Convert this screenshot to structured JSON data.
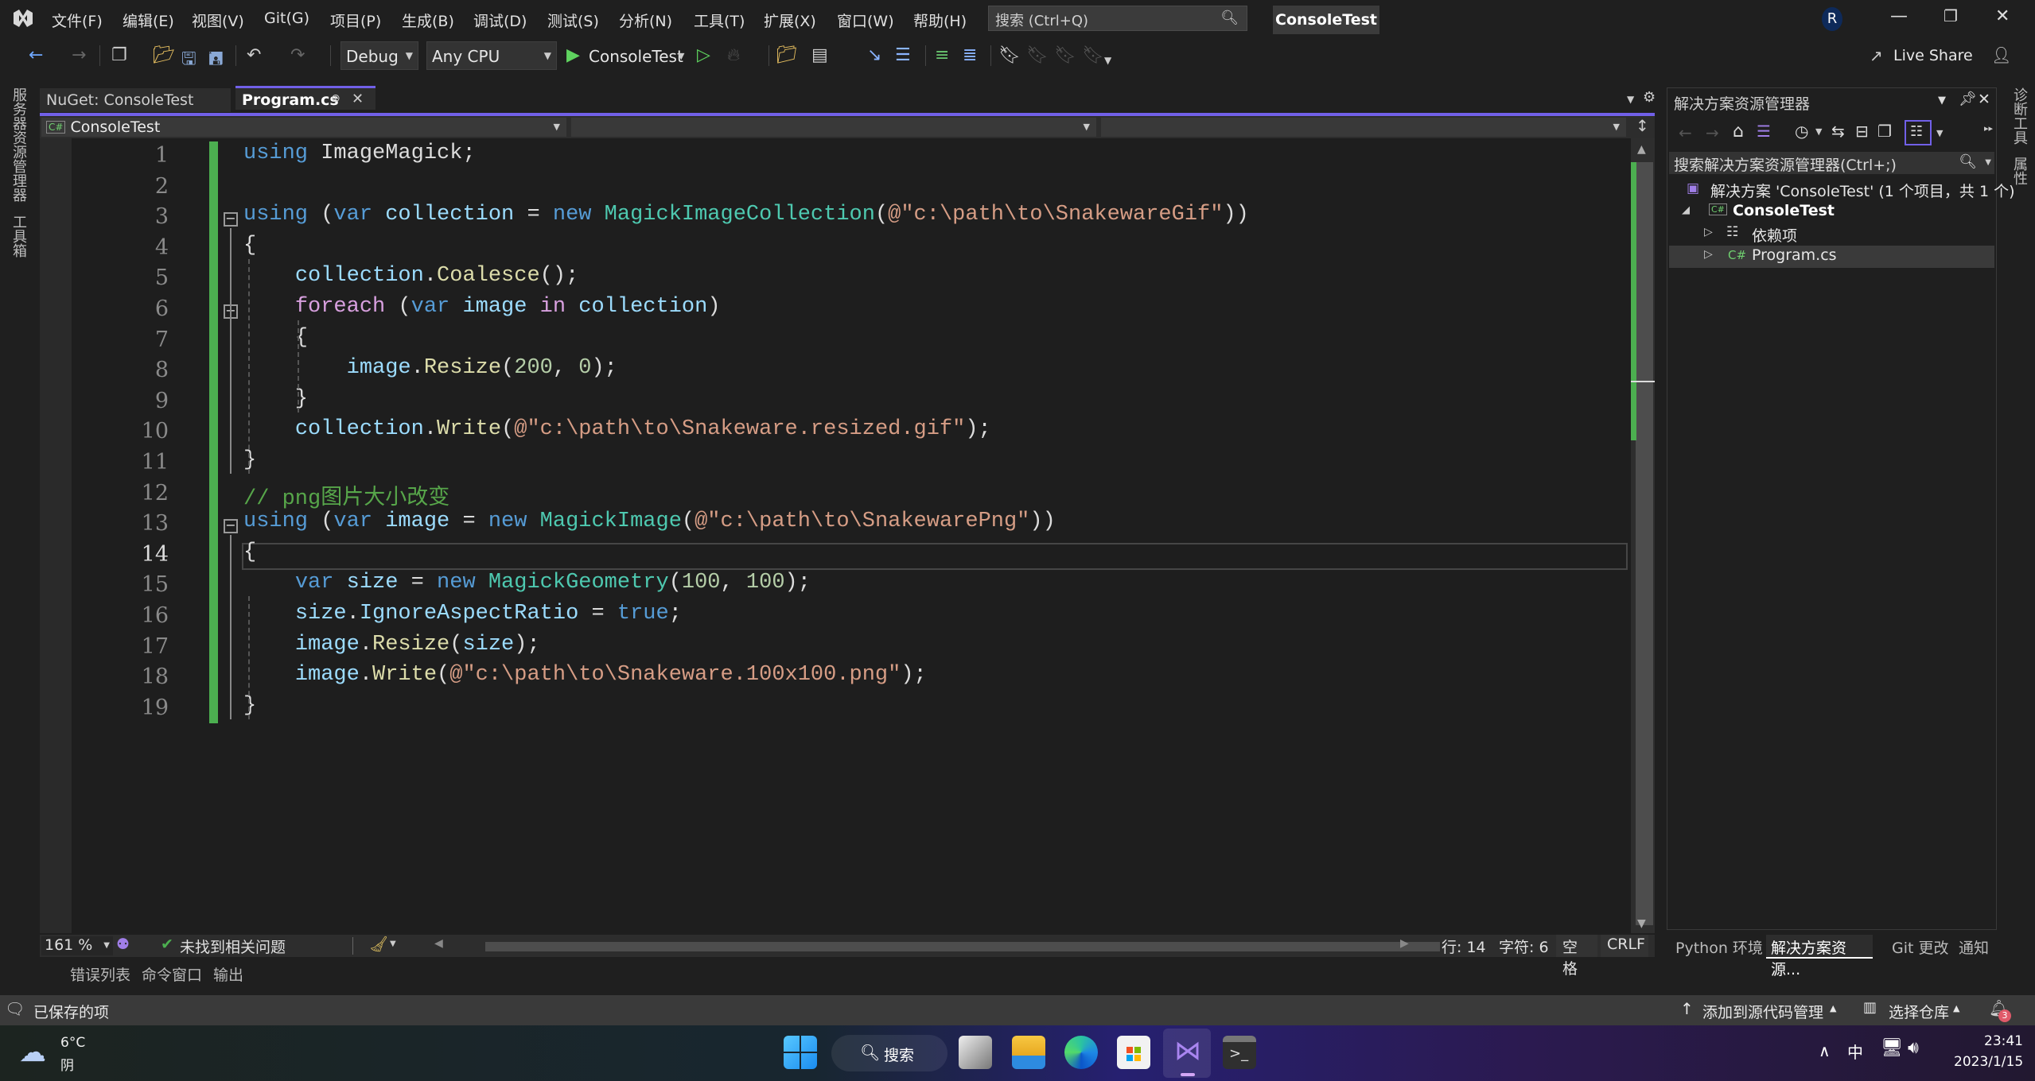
{
  "titlebar": {
    "menu": [
      "文件(F)",
      "编辑(E)",
      "视图(V)",
      "Git(G)",
      "项目(P)",
      "生成(B)",
      "调试(D)",
      "测试(S)",
      "分析(N)",
      "工具(T)",
      "扩展(X)",
      "窗口(W)",
      "帮助(H)"
    ],
    "search_placeholder": "搜索 (Ctrl+Q)",
    "solution_name": "ConsoleTest",
    "avatar_initial": "R",
    "live_share": "Live Share"
  },
  "toolbar": {
    "configuration": "Debug",
    "platform": "Any CPU",
    "start_target": "ConsoleTest"
  },
  "left_strip": [
    "服务器资源管理器",
    "工具箱"
  ],
  "right_strip": [
    "诊断工具",
    "属性"
  ],
  "tabs": [
    {
      "label": "NuGet: ConsoleTest",
      "active": false
    },
    {
      "label": "Program.cs",
      "active": true
    }
  ],
  "navbar": {
    "project": "ConsoleTest",
    "type": "",
    "member": ""
  },
  "editor": {
    "current_line": 14,
    "lines": [
      [
        [
          "kw",
          "using"
        ],
        [
          "pn",
          " ImageMagick;"
        ]
      ],
      [],
      [
        [
          "kw",
          "using"
        ],
        [
          "pn",
          " ("
        ],
        [
          "kw",
          "var"
        ],
        [
          "id",
          " collection"
        ],
        [
          "pn",
          " = "
        ],
        [
          "kw",
          "new"
        ],
        [
          "ty",
          " MagickImageCollection"
        ],
        [
          "pn",
          "("
        ],
        [
          "str",
          "@\"c:\\path\\to\\SnakewareGif\""
        ],
        [
          "pn",
          "))"
        ]
      ],
      [
        [
          "pn",
          "{"
        ]
      ],
      [
        [
          "pn",
          "    "
        ],
        [
          "id",
          "collection"
        ],
        [
          "pn",
          "."
        ],
        [
          "mth",
          "Coalesce"
        ],
        [
          "pn",
          "();"
        ]
      ],
      [
        [
          "pn",
          "    "
        ],
        [
          "ctl",
          "foreach"
        ],
        [
          "pn",
          " ("
        ],
        [
          "kw",
          "var"
        ],
        [
          "id",
          " image"
        ],
        [
          "ctl",
          " in"
        ],
        [
          "id",
          " collection"
        ],
        [
          "pn",
          ")"
        ]
      ],
      [
        [
          "pn",
          "    {"
        ]
      ],
      [
        [
          "pn",
          "        "
        ],
        [
          "id",
          "image"
        ],
        [
          "pn",
          "."
        ],
        [
          "mth",
          "Resize"
        ],
        [
          "pn",
          "("
        ],
        [
          "num",
          "200"
        ],
        [
          "pn",
          ", "
        ],
        [
          "num",
          "0"
        ],
        [
          "pn",
          ");"
        ]
      ],
      [
        [
          "pn",
          "    }"
        ]
      ],
      [
        [
          "pn",
          "    "
        ],
        [
          "id",
          "collection"
        ],
        [
          "pn",
          "."
        ],
        [
          "mth",
          "Write"
        ],
        [
          "pn",
          "("
        ],
        [
          "str",
          "@\"c:\\path\\to\\Snakeware.resized.gif\""
        ],
        [
          "pn",
          ");"
        ]
      ],
      [
        [
          "pn",
          "}"
        ]
      ],
      [
        [
          "cmt",
          "// png图片大小改变"
        ]
      ],
      [
        [
          "kw",
          "using"
        ],
        [
          "pn",
          " ("
        ],
        [
          "kw",
          "var"
        ],
        [
          "id",
          " image"
        ],
        [
          "pn",
          " = "
        ],
        [
          "kw",
          "new"
        ],
        [
          "ty",
          " MagickImage"
        ],
        [
          "pn",
          "("
        ],
        [
          "str",
          "@\"c:\\path\\to\\SnakewarePng\""
        ],
        [
          "pn",
          "))"
        ]
      ],
      [
        [
          "pn",
          "{"
        ]
      ],
      [
        [
          "pn",
          "    "
        ],
        [
          "kw",
          "var"
        ],
        [
          "id",
          " size"
        ],
        [
          "pn",
          " = "
        ],
        [
          "kw",
          "new"
        ],
        [
          "ty",
          " MagickGeometry"
        ],
        [
          "pn",
          "("
        ],
        [
          "num",
          "100"
        ],
        [
          "pn",
          ", "
        ],
        [
          "num",
          "100"
        ],
        [
          "pn",
          ");"
        ]
      ],
      [
        [
          "pn",
          "    "
        ],
        [
          "id",
          "size"
        ],
        [
          "pn",
          "."
        ],
        [
          "id",
          "IgnoreAspectRatio"
        ],
        [
          "pn",
          " = "
        ],
        [
          "kw",
          "true"
        ],
        [
          "pn",
          ";"
        ]
      ],
      [
        [
          "pn",
          "    "
        ],
        [
          "id",
          "image"
        ],
        [
          "pn",
          "."
        ],
        [
          "mth",
          "Resize"
        ],
        [
          "pn",
          "("
        ],
        [
          "id",
          "size"
        ],
        [
          "pn",
          ");"
        ]
      ],
      [
        [
          "pn",
          "    "
        ],
        [
          "id",
          "image"
        ],
        [
          "pn",
          "."
        ],
        [
          "mth",
          "Write"
        ],
        [
          "pn",
          "("
        ],
        [
          "str",
          "@\"c:\\path\\to\\Snakeware.100x100.png\""
        ],
        [
          "pn",
          ");"
        ]
      ],
      [
        [
          "pn",
          "}"
        ]
      ]
    ]
  },
  "editor_status": {
    "zoom": "161 %",
    "issues": "未找到相关问题",
    "line": "行: 14",
    "char": "字符: 6",
    "whitespace": "空格",
    "line_ending": "CRLF"
  },
  "bottom_tabs": [
    "错误列表",
    "命令窗口",
    "输出"
  ],
  "solution_explorer": {
    "title": "解决方案资源管理器",
    "search_placeholder": "搜索解决方案资源管理器(Ctrl+;)",
    "tree": [
      {
        "label": "解决方案 'ConsoleTest' (1 个项目，共 1 个)",
        "depth": 0,
        "icon": "solution-icon"
      },
      {
        "label": "ConsoleTest",
        "depth": 1,
        "icon": "csharp-project-icon",
        "expanded": true
      },
      {
        "label": "依赖项",
        "depth": 2,
        "icon": "dependencies-icon"
      },
      {
        "label": "Program.cs",
        "depth": 2,
        "icon": "csharp-file-icon",
        "selected": true
      }
    ],
    "bottom_tabs": [
      {
        "label": "Python 环境",
        "active": false
      },
      {
        "label": "解决方案资源...",
        "active": true
      },
      {
        "label": "Git 更改",
        "active": false
      },
      {
        "label": "通知",
        "active": false
      }
    ]
  },
  "statusbar": {
    "saved": "已保存的项",
    "add_source_control": "添加到源代码管理",
    "select_repo": "选择仓库",
    "notification_count": "3"
  },
  "taskbar": {
    "weather_temp": "6°C",
    "weather_desc": "阴",
    "search_label": "搜索",
    "ime": "中",
    "time": "23:41",
    "date": "2023/1/15"
  },
  "colors": {
    "accent": "#7160e8",
    "change_bar": "#4caf50",
    "keyword": "#569cd6",
    "type": "#4ec9b0",
    "string": "#d69d85",
    "comment": "#57a64a"
  }
}
